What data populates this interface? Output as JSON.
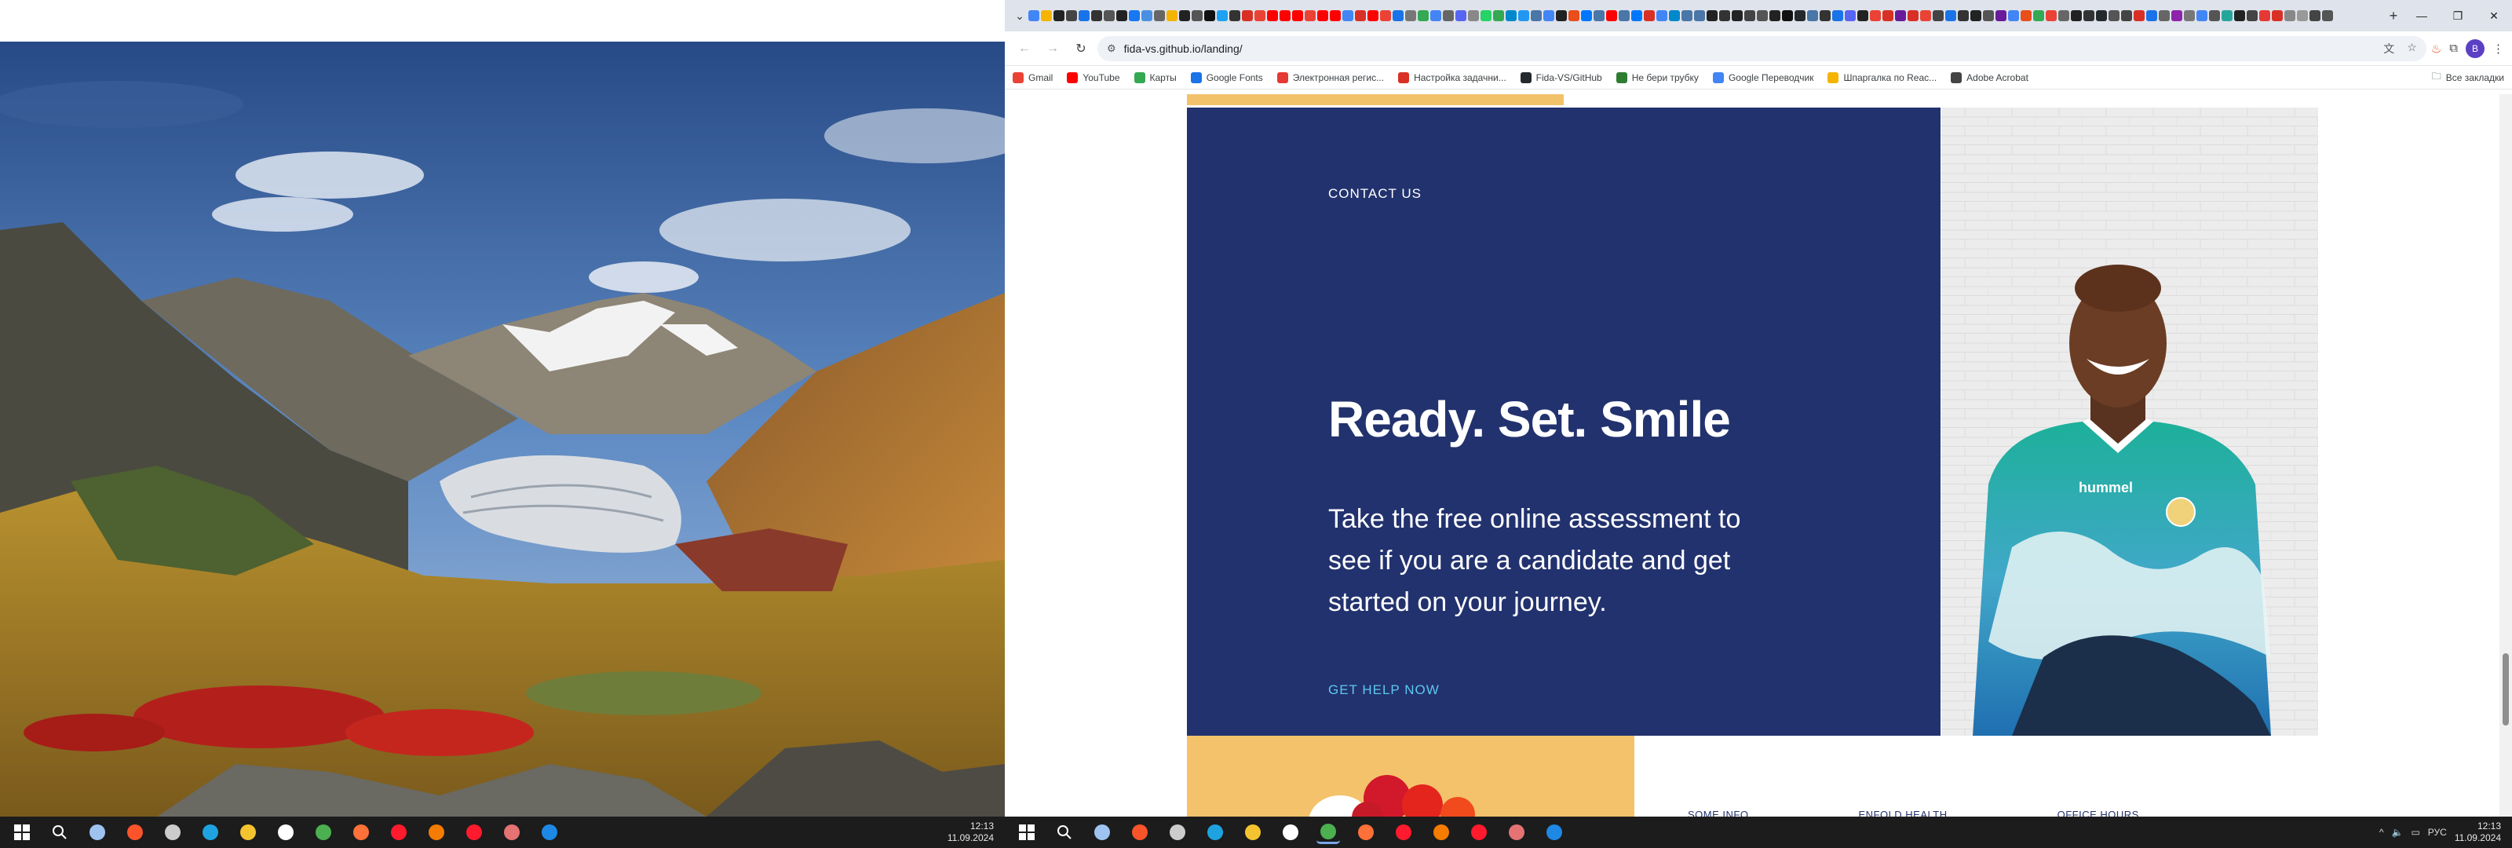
{
  "browser": {
    "url": "fida-vs.github.io/landing/",
    "profile_initial": "B",
    "tab_colors": [
      "#4285f4",
      "#f4b400",
      "#222",
      "#444",
      "#1a73e8",
      "#333",
      "#555",
      "#222",
      "#1877f2",
      "#4a90e2",
      "#666",
      "#f4b400",
      "#222",
      "#555",
      "#111",
      "#1da1f2",
      "#333",
      "#d93025",
      "#ea4335",
      "#ff0000",
      "#ff0000",
      "#ff0000",
      "#ea4335",
      "#ff0000",
      "#ff0000",
      "#4285f4",
      "#d93025",
      "#ff0000",
      "#ea4335",
      "#1a73e8",
      "#777",
      "#34a853",
      "#4285f4",
      "#666",
      "#5865f2",
      "#888",
      "#25d366",
      "#34a853",
      "#0088cc",
      "#2196f3",
      "#4a76a8",
      "#4285f4",
      "#222",
      "#e94e1b",
      "#0077ff",
      "#4a76a8",
      "#ff0000",
      "#4a76a8",
      "#0077ff",
      "#d93025",
      "#4285f4",
      "#0088cc",
      "#4a76a8",
      "#4a76a8",
      "#222",
      "#333",
      "#222",
      "#444",
      "#555",
      "#222",
      "#111",
      "#24292e",
      "#4a76a8",
      "#333",
      "#1a73e8",
      "#5865f2",
      "#222",
      "#ea4335",
      "#d93025",
      "#6a1b9a",
      "#d93025",
      "#ea4335",
      "#444",
      "#1a73e8",
      "#333",
      "#222",
      "#555",
      "#6a1b9a",
      "#4285f4",
      "#e94e1b",
      "#34a853",
      "#ea4335",
      "#666",
      "#222",
      "#333",
      "#24292e",
      "#555",
      "#444",
      "#d93025",
      "#1a73e8",
      "#666",
      "#8e24aa",
      "#777",
      "#4285f4",
      "#555",
      "#26a69a",
      "#222",
      "#444",
      "#e53935",
      "#d93025",
      "#888",
      "#999",
      "#444",
      "#555"
    ]
  },
  "bookmarks": [
    {
      "label": "Gmail",
      "color": "#ea4335"
    },
    {
      "label": "YouTube",
      "color": "#ff0000"
    },
    {
      "label": "Карты",
      "color": "#34a853"
    },
    {
      "label": "Google Fonts",
      "color": "#1a73e8"
    },
    {
      "label": "Электронная регис...",
      "color": "#e53935"
    },
    {
      "label": "Настройка задачни...",
      "color": "#d93025"
    },
    {
      "label": "Fida-VS/GitHub",
      "color": "#24292e"
    },
    {
      "label": "Не бери трубку",
      "color": "#2e7d32"
    },
    {
      "label": "Google Переводчик",
      "color": "#4285f4"
    },
    {
      "label": "Шпаргалка по Reac...",
      "color": "#f4b400"
    },
    {
      "label": "Adobe Acrobat",
      "color": "#444"
    }
  ],
  "bookmarks_other": "Все закладки",
  "page": {
    "contact_label": "CONTACT US",
    "headline": "Ready. Set. Smile",
    "subtext": "Take the free online assessment to see if you are a candidate and get started on your journey.",
    "cta": "GET HELP NOW",
    "footer_cols": [
      "SOME INFO",
      "ENFOLD HEALTH",
      "OFFICE HOURS"
    ],
    "scroll_position": 0.86,
    "scroll_thumb_fraction": 0.1
  },
  "taskbar_left": {
    "icons": [
      {
        "name": "windows-start",
        "color": "#ffffff"
      },
      {
        "name": "search",
        "color": "#ffffff"
      },
      {
        "name": "notepad",
        "color": "#9fc3f1"
      },
      {
        "name": "brave",
        "color": "#fb542b"
      },
      {
        "name": "app-gray",
        "color": "#cccccc"
      },
      {
        "name": "edge",
        "color": "#1fa3e0"
      },
      {
        "name": "file-explorer",
        "color": "#f4c430"
      },
      {
        "name": "yandex",
        "color": "#ffffff"
      },
      {
        "name": "chrome",
        "color": "#4caf50"
      },
      {
        "name": "firefox",
        "color": "#ff7139"
      },
      {
        "name": "opera",
        "color": "#ff1b2d"
      },
      {
        "name": "app-orange",
        "color": "#f57c00"
      },
      {
        "name": "opera-gx",
        "color": "#ff1b2d"
      },
      {
        "name": "app-stack",
        "color": "#e57373"
      },
      {
        "name": "vscode",
        "color": "#1e88e5"
      }
    ],
    "time": "12:13",
    "date": "11.09.2024"
  },
  "taskbar_right": {
    "icons": [
      {
        "name": "windows-start",
        "color": "#ffffff"
      },
      {
        "name": "search",
        "color": "#ffffff"
      },
      {
        "name": "notepad",
        "color": "#9fc3f1"
      },
      {
        "name": "brave",
        "color": "#fb542b"
      },
      {
        "name": "app-gray",
        "color": "#cccccc"
      },
      {
        "name": "edge",
        "color": "#1fa3e0"
      },
      {
        "name": "file-explorer",
        "color": "#f4c430"
      },
      {
        "name": "yandex",
        "color": "#ffffff"
      },
      {
        "name": "chrome",
        "color": "#4caf50",
        "active": true
      },
      {
        "name": "firefox",
        "color": "#ff7139"
      },
      {
        "name": "opera",
        "color": "#ff1b2d"
      },
      {
        "name": "app-orange",
        "color": "#f57c00"
      },
      {
        "name": "opera-gx",
        "color": "#ff1b2d"
      },
      {
        "name": "app-stack",
        "color": "#e57373"
      },
      {
        "name": "vscode",
        "color": "#1e88e5"
      }
    ],
    "lang": "РУС",
    "time": "12:13",
    "date": "11.09.2024"
  }
}
